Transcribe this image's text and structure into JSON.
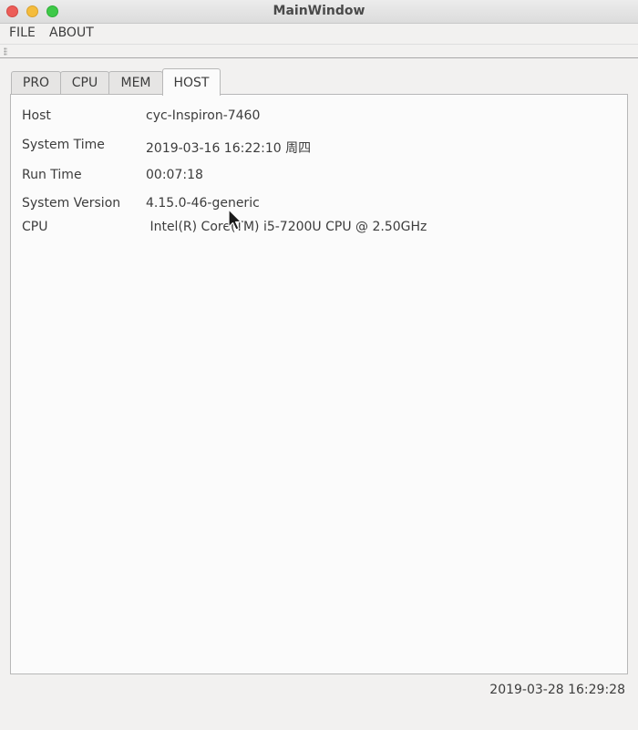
{
  "window": {
    "title": "MainWindow"
  },
  "menu": {
    "items": [
      "FILE",
      "ABOUT"
    ]
  },
  "tabs": [
    {
      "label": "PRO",
      "active": false
    },
    {
      "label": "CPU",
      "active": false
    },
    {
      "label": "MEM",
      "active": false
    },
    {
      "label": "HOST",
      "active": true
    }
  ],
  "host_info": [
    {
      "label": "Host",
      "value": "cyc-Inspiron-7460"
    },
    {
      "label": "System Time",
      "value": "2019-03-16 16:22:10 周四"
    },
    {
      "label": "Run Time",
      "value": "00:07:18"
    },
    {
      "label": "System Version",
      "value": "4.15.0-46-generic"
    },
    {
      "label": "CPU",
      "value": " Intel(R) Core(TM) i5-7200U CPU @ 2.50GHz"
    }
  ],
  "status_bar": {
    "datetime": "2019-03-28 16:29:28"
  }
}
